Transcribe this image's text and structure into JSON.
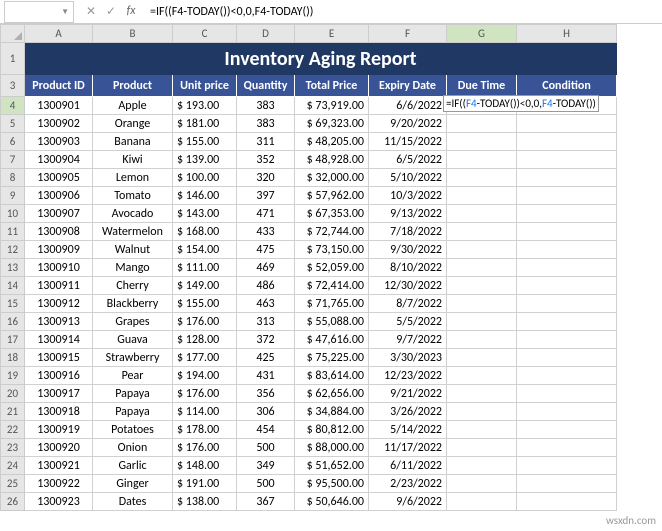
{
  "nameBox": "",
  "formulaBar": "=IF((F4-TODAY())<0,0,F4-TODAY())",
  "columns": [
    "A",
    "B",
    "C",
    "D",
    "E",
    "F",
    "G",
    "H"
  ],
  "selectedCol": "G",
  "selectedRow": 4,
  "title": "Inventory Aging Report",
  "headers": {
    "A": "Product ID",
    "B": "Product",
    "C": "Unit price",
    "D": "Quantity",
    "E": "Total Price",
    "F": "Expiry Date",
    "G": "Due Time",
    "H": "Condition"
  },
  "overlay": {
    "prefix": "=IF((",
    "ref1": "F4",
    "mid1": "-",
    "fn1": "TODAY",
    "mid2": "())<0,0,",
    "ref2": "F4",
    "mid3": "-",
    "fn2": "TODAY",
    "suffix": "())"
  },
  "rows": [
    {
      "n": 4,
      "id": "1300901",
      "p": "Apple",
      "u": "$  193.00",
      "q": "383",
      "t": "$ 73,919.00",
      "d": "6/6/2022"
    },
    {
      "n": 5,
      "id": "1300902",
      "p": "Orange",
      "u": "$  181.00",
      "q": "383",
      "t": "$ 69,323.00",
      "d": "9/20/2022"
    },
    {
      "n": 6,
      "id": "1300903",
      "p": "Banana",
      "u": "$  155.00",
      "q": "311",
      "t": "$ 48,205.00",
      "d": "11/15/2022"
    },
    {
      "n": 7,
      "id": "1300904",
      "p": "Kiwi",
      "u": "$  139.00",
      "q": "352",
      "t": "$ 48,928.00",
      "d": "6/5/2022"
    },
    {
      "n": 8,
      "id": "1300905",
      "p": "Lemon",
      "u": "$  100.00",
      "q": "320",
      "t": "$ 32,000.00",
      "d": "5/10/2022"
    },
    {
      "n": 9,
      "id": "1300906",
      "p": "Tomato",
      "u": "$  146.00",
      "q": "397",
      "t": "$ 57,962.00",
      "d": "10/3/2022"
    },
    {
      "n": 10,
      "id": "1300907",
      "p": "Avocado",
      "u": "$  143.00",
      "q": "471",
      "t": "$ 67,353.00",
      "d": "9/13/2022"
    },
    {
      "n": 11,
      "id": "1300908",
      "p": "Watermelon",
      "u": "$  168.00",
      "q": "433",
      "t": "$ 72,744.00",
      "d": "7/18/2022"
    },
    {
      "n": 12,
      "id": "1300909",
      "p": "Walnut",
      "u": "$  154.00",
      "q": "475",
      "t": "$ 73,150.00",
      "d": "9/30/2022"
    },
    {
      "n": 13,
      "id": "1300910",
      "p": "Mango",
      "u": "$  111.00",
      "q": "469",
      "t": "$ 52,059.00",
      "d": "8/10/2022"
    },
    {
      "n": 14,
      "id": "1300911",
      "p": "Cherry",
      "u": "$  149.00",
      "q": "486",
      "t": "$ 72,414.00",
      "d": "12/30/2022"
    },
    {
      "n": 15,
      "id": "1300912",
      "p": "Blackberry",
      "u": "$  155.00",
      "q": "463",
      "t": "$ 71,765.00",
      "d": "8/7/2022"
    },
    {
      "n": 16,
      "id": "1300913",
      "p": "Grapes",
      "u": "$  176.00",
      "q": "313",
      "t": "$ 55,088.00",
      "d": "5/5/2022"
    },
    {
      "n": 17,
      "id": "1300914",
      "p": "Guava",
      "u": "$  128.00",
      "q": "372",
      "t": "$ 47,616.00",
      "d": "9/7/2022"
    },
    {
      "n": 18,
      "id": "1300915",
      "p": "Strawberry",
      "u": "$  177.00",
      "q": "425",
      "t": "$ 75,225.00",
      "d": "3/30/2023"
    },
    {
      "n": 19,
      "id": "1300916",
      "p": "Pear",
      "u": "$  194.00",
      "q": "431",
      "t": "$ 83,614.00",
      "d": "12/23/2022"
    },
    {
      "n": 20,
      "id": "1300917",
      "p": "Papaya",
      "u": "$  176.00",
      "q": "356",
      "t": "$ 62,656.00",
      "d": "9/21/2022"
    },
    {
      "n": 21,
      "id": "1300918",
      "p": "Papaya",
      "u": "$  114.00",
      "q": "306",
      "t": "$ 34,884.00",
      "d": "3/26/2022"
    },
    {
      "n": 22,
      "id": "1300919",
      "p": "Potatoes",
      "u": "$  178.00",
      "q": "454",
      "t": "$ 80,812.00",
      "d": "5/14/2022"
    },
    {
      "n": 23,
      "id": "1300920",
      "p": "Onion",
      "u": "$  176.00",
      "q": "500",
      "t": "$ 88,000.00",
      "d": "11/17/2022"
    },
    {
      "n": 24,
      "id": "1300921",
      "p": "Garlic",
      "u": "$  148.00",
      "q": "349",
      "t": "$ 51,652.00",
      "d": "6/11/2022"
    },
    {
      "n": 25,
      "id": "1300922",
      "p": "Ginger",
      "u": "$  191.00",
      "q": "500",
      "t": "$ 95,500.00",
      "d": "2/23/2022"
    },
    {
      "n": 26,
      "id": "1300923",
      "p": "Dates",
      "u": "$  138.00",
      "q": "367",
      "t": "$ 50,646.00",
      "d": "9/6/2022"
    }
  ],
  "watermark": "wsxdn.com"
}
